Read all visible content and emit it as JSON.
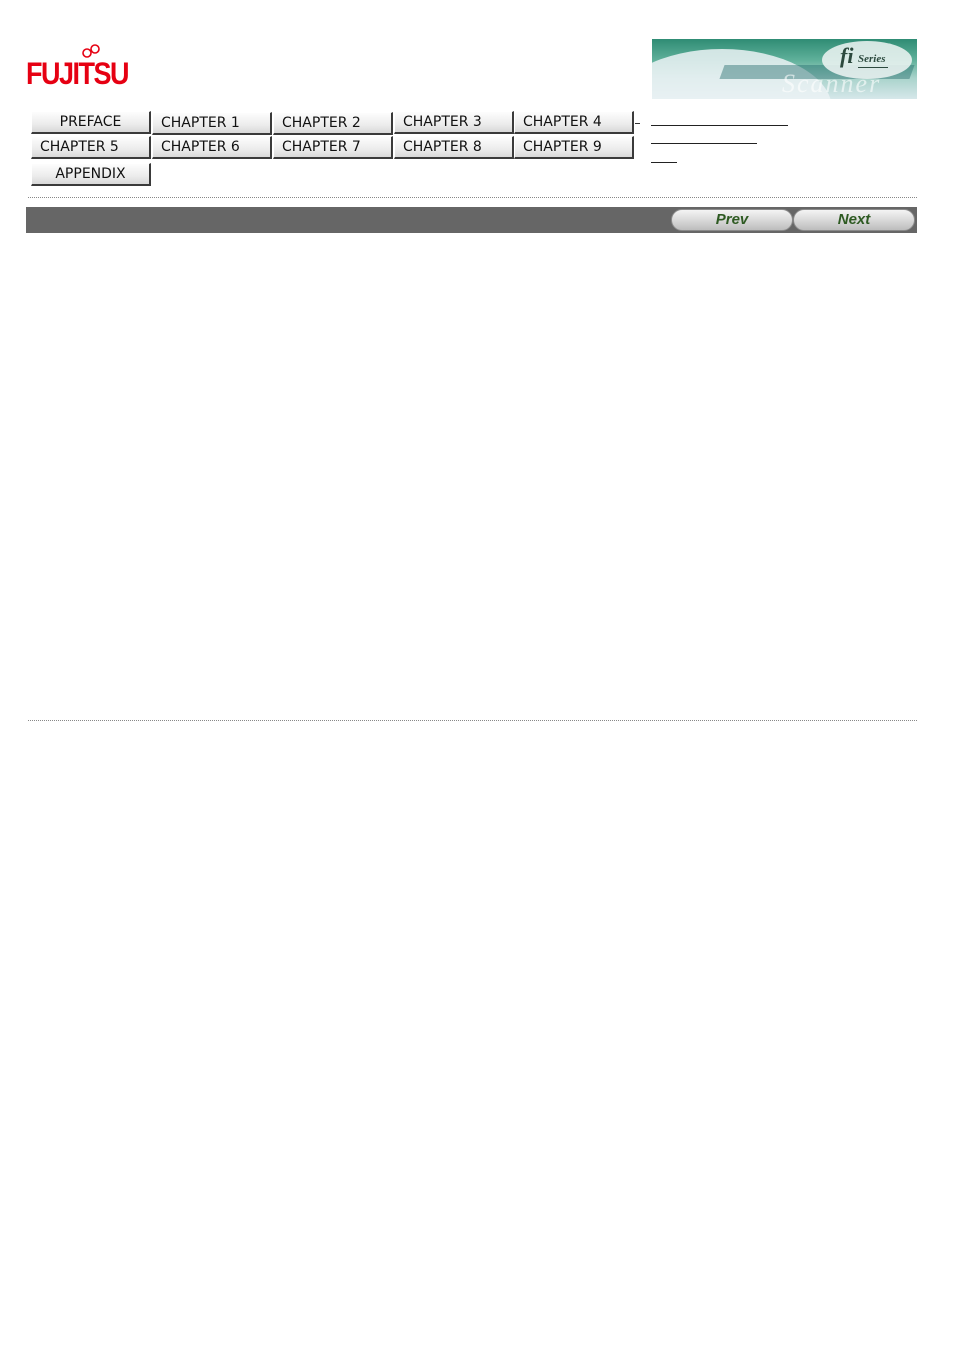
{
  "header": {
    "logo_text": "FUJITSU",
    "banner": {
      "brand": "fi",
      "series": "Series",
      "product_word": "Scanner"
    }
  },
  "nav": {
    "buttons": [
      {
        "label": "PREFACE",
        "row": 1
      },
      {
        "label": "CHAPTER 1",
        "row": 1
      },
      {
        "label": "CHAPTER 2",
        "row": 1
      },
      {
        "label": "CHAPTER 3",
        "row": 1
      },
      {
        "label": "CHAPTER 4",
        "row": 1
      },
      {
        "label": "CHAPTER 5",
        "row": 2
      },
      {
        "label": "CHAPTER 6",
        "row": 2
      },
      {
        "label": "CHAPTER 7",
        "row": 2
      },
      {
        "label": "CHAPTER 8",
        "row": 2
      },
      {
        "label": "CHAPTER 9",
        "row": 2
      },
      {
        "label": "APPENDIX",
        "row": 3
      }
    ],
    "side_links": [
      "",
      "",
      ""
    ]
  },
  "toolbar": {
    "prev_label": "Prev",
    "next_label": "Next"
  }
}
